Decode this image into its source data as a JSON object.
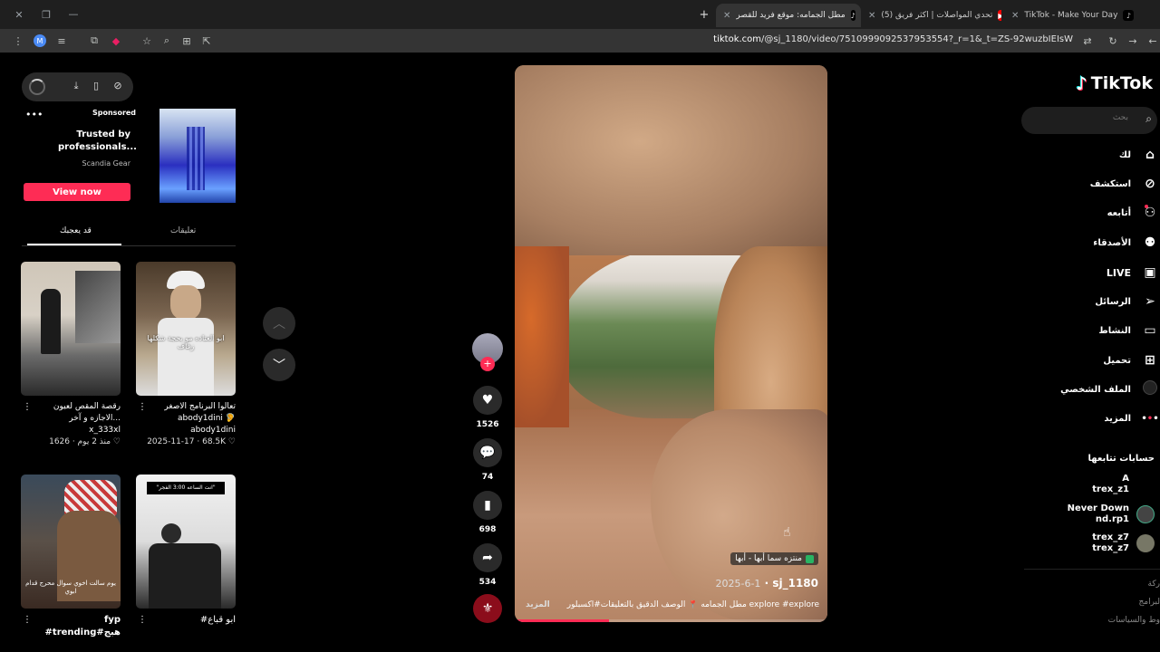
{
  "browser": {
    "tabs": [
      {
        "label": "TikTok - Make Your Day"
      },
      {
        "label": "(5) تحدي المواصلات | اكثر فريق"
      },
      {
        "label": "مطل الجمامه: موقع فريد للقصر"
      }
    ],
    "url_domain": "tiktok.com",
    "url_rest": "/@sj_1180/video/7510999092537953554?_r=1&_t=ZS-92wuzbIEIsW",
    "profile_initial": "M"
  },
  "sponsored": {
    "label": "Sponsored",
    "title": "Trusted by professionals...",
    "brand": "Scandia Gear",
    "cta": "View now"
  },
  "side_tabs": {
    "comments": "تعليقات",
    "you_may_like": "قد يعجبك"
  },
  "videos": [
    {
      "caption": "رقصة المقص لعيون الاجازه و آخر...",
      "author": "x_333xl",
      "likes": "1626",
      "date": "منذ 2 يوم"
    },
    {
      "caption": "تعالوا البرنامج الاصغر abody1dini 🦻",
      "author": "abody1dini",
      "likes": "68.5K",
      "date": "2025-11-17",
      "overlay": "ابو العتاده مو بحجة شكلها زفاف"
    },
    {
      "caption": "fyp #trending#هبج",
      "author": "",
      "likes": "",
      "date": "",
      "overlay": "يوم سالت اخوي سوال محرج قدام ابوي"
    },
    {
      "caption": "#ابو قباع",
      "author": "",
      "likes": "",
      "date": "",
      "overlay": "\"انت الساعه 3:00 الفجر\""
    }
  ],
  "actions": {
    "likes": "1526",
    "comments": "74",
    "saves": "698",
    "shares": "534"
  },
  "video_post": {
    "location": "منتزه سما أبها - أبها",
    "author": "sj_1180",
    "date": "2025-6-1",
    "description": "مطل الجمامه 📍 الوصف الدقيق بالتعليقات#اكسبلور explore #explore",
    "more": "المزيد",
    "progress": 0.3
  },
  "sidebar": {
    "search_placeholder": "بحث",
    "logo": "TikTok",
    "nav": [
      {
        "label": "لك"
      },
      {
        "label": "استكشف"
      },
      {
        "label": "أتابعه"
      },
      {
        "label": "الأصدقاء"
      },
      {
        "label": "LIVE"
      },
      {
        "label": "الرسائل"
      },
      {
        "label": "النشاط"
      },
      {
        "label": "تحميل"
      },
      {
        "label": "الملف الشخصي"
      },
      {
        "label": "المزيد"
      }
    ],
    "following_header": "حسابات تتابعها",
    "following": [
      {
        "name": "A",
        "handle": "trex_z1"
      },
      {
        "name": "Never Down",
        "handle": "nd.rp1"
      },
      {
        "name": "trex_z7",
        "handle": "trex_z7"
      }
    ],
    "footer": [
      "ركة",
      "لبرامج",
      "وط والسياسات"
    ]
  }
}
